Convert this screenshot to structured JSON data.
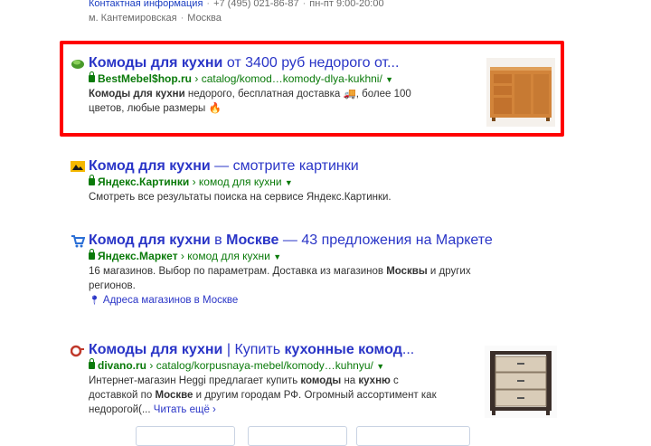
{
  "top_info": {
    "contact_link": "Контактная информация",
    "phone": "+7 (495) 021-86-87",
    "hours": "пн-пт 9:00-20:00",
    "metro": "м. Кантемировская",
    "city": "Москва"
  },
  "results": [
    {
      "title_bold": "Комоды для кухни",
      "title_rest": " от 3400 руб недорого от...",
      "host": "BestMebel$hop.ru",
      "path": "catalog/komod…komody-dlya-kukhni/",
      "snippet_b1": "Комоды для кухни",
      "snippet_t1": " недорого, бесплатная доставка 🚚, более 100",
      "snippet_t2": "цветов, любые размеры 🔥",
      "favicon": "green-ball-icon"
    },
    {
      "title_bold": "Комод для кухни",
      "title_rest": " — смотрите картинки",
      "host": "Яндекс.Картинки",
      "path": "комод для кухни",
      "snippet_t1": "Смотреть все результаты поиска на сервисе Яндекс.Картинки.",
      "favicon": "picture-icon"
    },
    {
      "title_bold": "Комод для кухни",
      "title_mid": " в ",
      "title_bold2": "Москве",
      "title_rest": " — 43 предложения на Маркете",
      "host": "Яндекс.Маркет",
      "path": "комод для кухни",
      "snippet_t1": "16 магазинов. Выбор по параметрам. Доставка из магазинов ",
      "snippet_b1": "Москвы",
      "snippet_t2": " и других",
      "snippet_t3": "регионов.",
      "address": "Адреса магазинов в Москве",
      "favicon": "cart-icon"
    },
    {
      "title_bold": "Комоды для кухни",
      "title_mid": " | Купить ",
      "title_bold2": "кухонные комод",
      "title_rest": "...",
      "host": "divano.ru",
      "path": "catalog/korpusnaya-mebel/komody…kuhnyu/",
      "snippet_t1": "Интернет-магазин Heggi предлагает купить ",
      "snippet_b1": "комоды",
      "snippet_t2": " на ",
      "snippet_b2": "кухню",
      "snippet_t3": " с",
      "snippet_t4": "доставкой по ",
      "snippet_b3": "Москве",
      "snippet_t5": " и другим городам РФ. Огромный ассортимент как",
      "snippet_t6": "недорогой(...",
      "read_more": "Читать ещё",
      "favicon": "divano-icon"
    }
  ],
  "colors": {
    "link": "#2a35c7",
    "url": "#0a7a0a",
    "highlight": "#ff0000"
  }
}
